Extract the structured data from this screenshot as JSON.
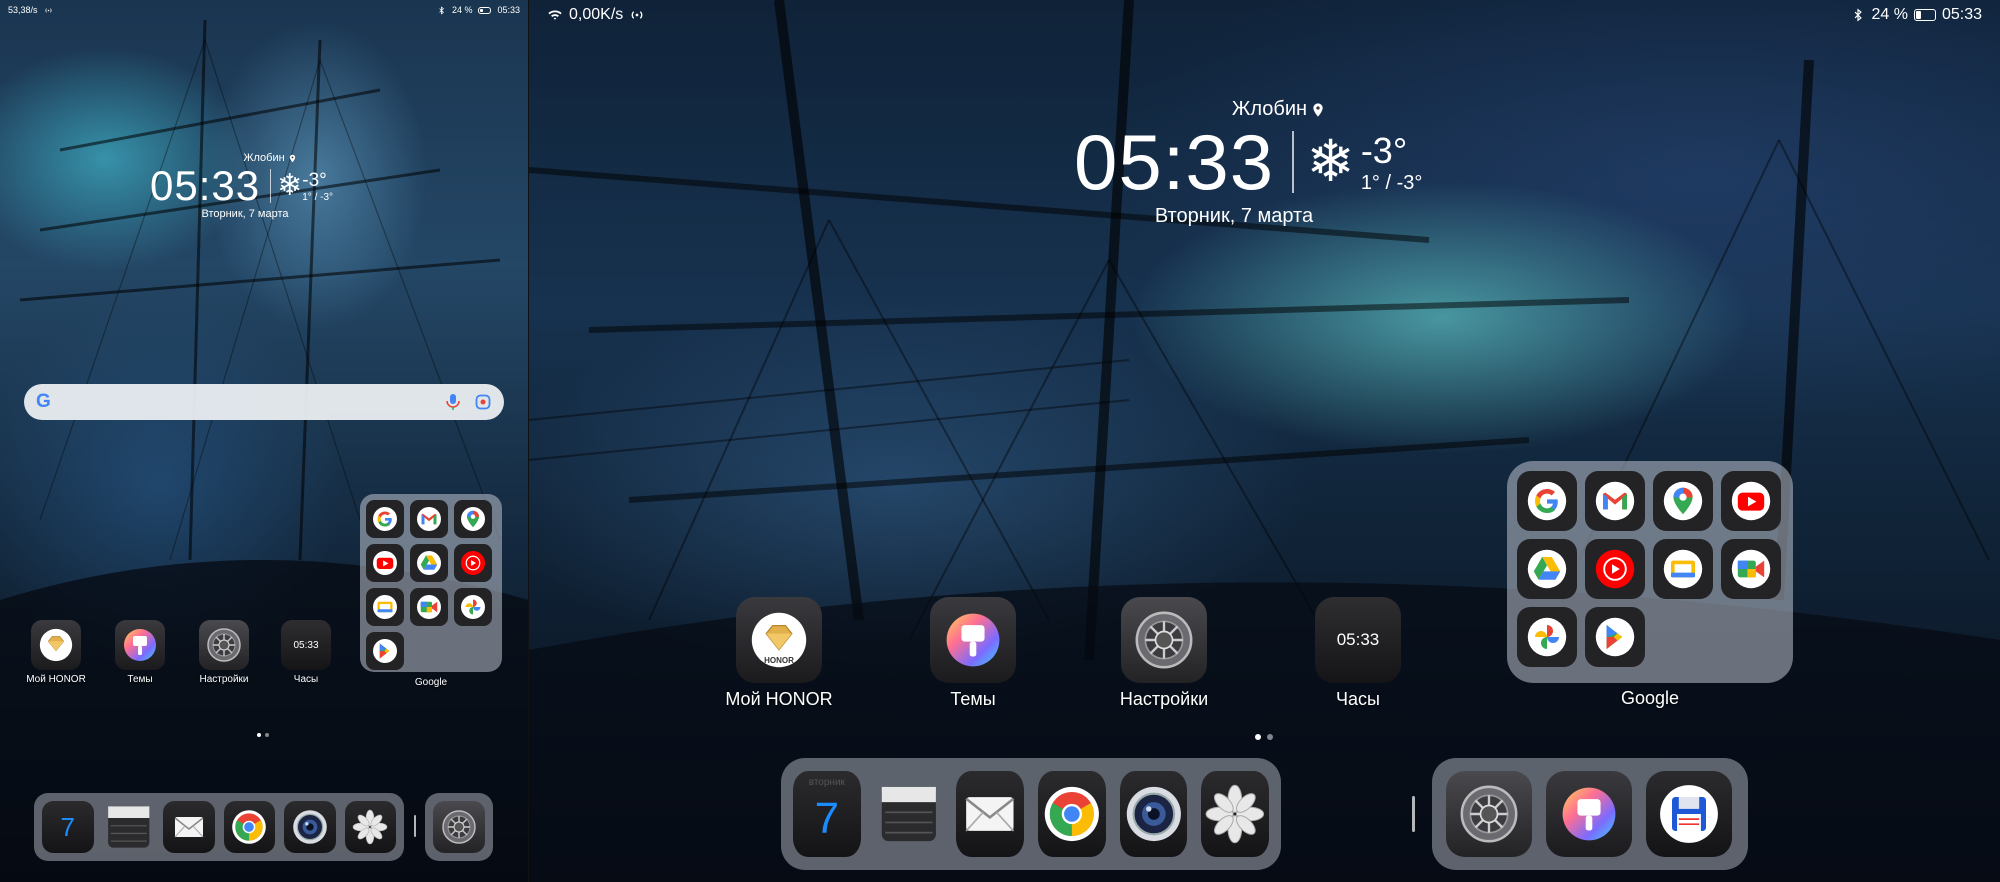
{
  "left": {
    "status": {
      "net_speed": "53,38/s",
      "battery": "24 %",
      "battery_level": 0.24,
      "time": "05:33"
    },
    "clock": {
      "city": "Жлобин",
      "time": "05:33",
      "temp": "-3°",
      "range": "1° / -3°",
      "date": "Вторник, 7 марта"
    },
    "search": {
      "logo": "G"
    },
    "apps": [
      {
        "label": "Мой HONOR",
        "icon": "honor-icon",
        "badge": "HONOR"
      },
      {
        "label": "Темы",
        "icon": "themes-brush-icon"
      },
      {
        "label": "Настройки",
        "icon": "settings-gear-icon"
      },
      {
        "label": "Часы",
        "icon": "clock-icon",
        "value": "05:33"
      }
    ],
    "folder": {
      "label": "Google",
      "items": [
        "google-search-icon",
        "gmail-icon",
        "google-maps-icon",
        "youtube-icon",
        "google-drive-icon",
        "youtube-music-icon",
        "google-tv-icon",
        "google-meet-icon",
        "google-photos-icon",
        "google-play-icon"
      ]
    },
    "dock": {
      "calendar_day": "7"
    }
  },
  "right": {
    "status": {
      "net_speed": "0,00K/s",
      "battery": "24 %",
      "battery_level": 0.24,
      "time": "05:33"
    },
    "clock": {
      "city": "Жлобин",
      "time": "05:33",
      "temp": "-3°",
      "range": "1° / -3°",
      "date": "Вторник, 7 марта"
    },
    "apps": [
      {
        "label": "Мой HONOR",
        "icon": "honor-icon",
        "badge": "HONOR"
      },
      {
        "label": "Темы",
        "icon": "themes-brush-icon"
      },
      {
        "label": "Настройки",
        "icon": "settings-gear-icon"
      },
      {
        "label": "Часы",
        "icon": "clock-icon",
        "value": "05:33"
      }
    ],
    "folder": {
      "label": "Google",
      "items": [
        "google-search-icon",
        "gmail-icon",
        "google-maps-icon",
        "youtube-icon",
        "google-drive-icon",
        "youtube-music-icon",
        "google-tv-icon",
        "google-meet-icon",
        "google-photos-icon",
        "google-play-icon"
      ]
    },
    "dock": {
      "calendar_weekday": "вторник",
      "calendar_day": "7",
      "main": [
        "calendar-icon",
        "notes-icon",
        "mail-icon",
        "chrome-icon",
        "camera-icon",
        "gallery-icon"
      ],
      "side": [
        "settings-gear-icon",
        "themes-brush-icon",
        "files-floppy-icon"
      ]
    }
  },
  "colors": {
    "accent_blue": "#1a8cff",
    "google_blue": "#4285f4",
    "google_red": "#ea4335",
    "google_yellow": "#fbbc05",
    "google_green": "#34a853",
    "honor_gold": "#e2b04a"
  }
}
